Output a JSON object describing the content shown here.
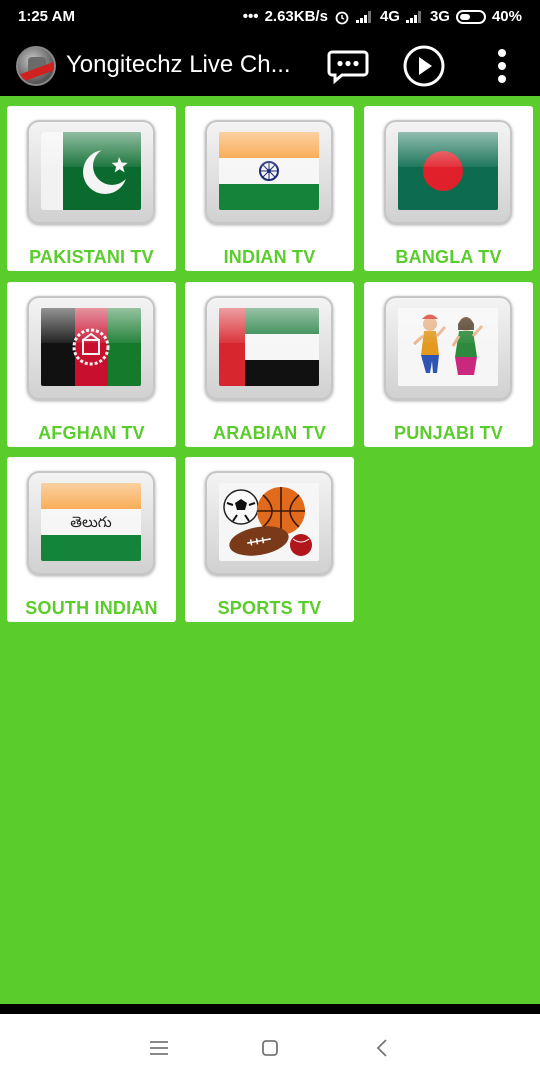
{
  "status": {
    "time": "1:25 AM",
    "speed": "2.63KB/s",
    "net1": "4G",
    "net2": "3G",
    "battery": "40%"
  },
  "appbar": {
    "title": "Yongitechz Live Ch...",
    "icons": [
      "chat-icon",
      "play-icon",
      "more-vert-icon"
    ]
  },
  "channels": [
    {
      "label": "PAKISTANI TV",
      "icon": "pakistan-flag"
    },
    {
      "label": "INDIAN TV",
      "icon": "india-flag"
    },
    {
      "label": "BANGLA TV",
      "icon": "bangladesh-flag"
    },
    {
      "label": "AFGHAN TV",
      "icon": "afghanistan-flag"
    },
    {
      "label": "ARABIAN TV",
      "icon": "uae-flag"
    },
    {
      "label": "PUNJABI TV",
      "icon": "punjabi-dancers"
    },
    {
      "label": "SOUTH INDIAN",
      "icon": "telugu-flag",
      "text": "తెలుగు"
    },
    {
      "label": "SPORTS TV",
      "icon": "sports-balls"
    }
  ],
  "colors": {
    "background": "#5acd2c",
    "label": "#5acd2c",
    "bar": "#000000"
  }
}
